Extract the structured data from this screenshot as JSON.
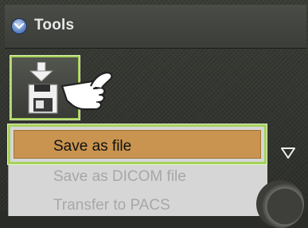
{
  "panel": {
    "title": "Tools",
    "collapse_icon": "chevron-down-circle-icon"
  },
  "toolbar": {
    "save_tool_icon": "save-disk-download-icon",
    "cursor_icon": "pointing-hand-cursor"
  },
  "menu": {
    "items": [
      {
        "label": "Save as file",
        "state": "highlighted"
      },
      {
        "label": "Save as DICOM file",
        "state": "disabled"
      },
      {
        "label": "Transfer to PACS",
        "state": "disabled"
      }
    ],
    "expand_icon": "triangle-down-icon"
  },
  "colors": {
    "highlight_border": "#a6d25b",
    "selected_item_bg": "#c99450",
    "menu_bg": "#d6d6d6",
    "disabled_text": "#a7a7a7",
    "header_bg": "#444640"
  }
}
